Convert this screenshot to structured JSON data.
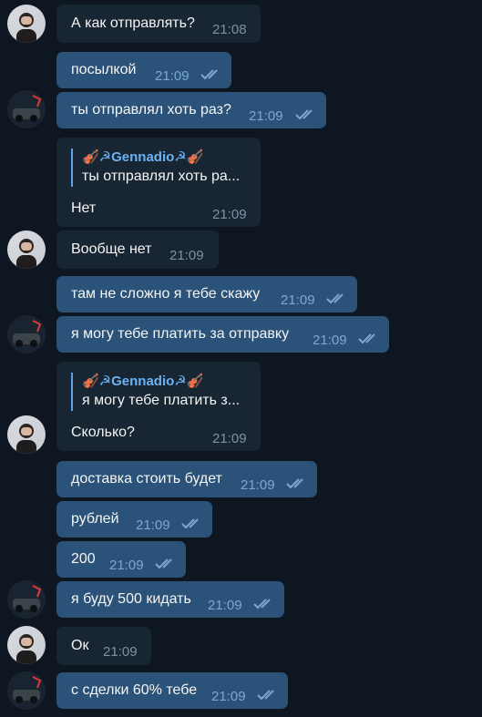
{
  "messages": [
    {
      "text": "А как отправлять?",
      "time": "21:08"
    },
    {
      "text": "посылкой",
      "time": "21:09"
    },
    {
      "text": "ты отправлял хоть раз?",
      "time": "21:09"
    },
    {
      "reply_name": "🎻☭Gennadio☭🎻",
      "reply_text": "ты отправлял хоть ра...",
      "text": "Нет",
      "time": "21:09"
    },
    {
      "text": "Вообще нет",
      "time": "21:09"
    },
    {
      "text": "там не сложно я тебе скажу",
      "time": "21:09"
    },
    {
      "text": "я могу тебе платить за отправку",
      "time": "21:09"
    },
    {
      "reply_name": "🎻☭Gennadio☭🎻",
      "reply_text": "я могу тебе платить з...",
      "text": "Сколько?",
      "time": "21:09"
    },
    {
      "text": "доставка стоить будет",
      "time": "21:09"
    },
    {
      "text": "рублей",
      "time": "21:09"
    },
    {
      "text": "200",
      "time": "21:09"
    },
    {
      "text": "я буду 500 кидать",
      "time": "21:09"
    },
    {
      "text": "Ок",
      "time": "21:09"
    },
    {
      "text": "с сделки 60% тебе",
      "time": "21:09"
    }
  ],
  "colors": {
    "background": "#0e1621",
    "incoming_bubble": "#182533",
    "outgoing_bubble": "#2b5278",
    "reply_accent": "#6ab3f3",
    "read_check": "#7da8d3"
  },
  "icons": [
    "user-avatar-icon",
    "contact-avatar-icon",
    "double-check-icon"
  ]
}
